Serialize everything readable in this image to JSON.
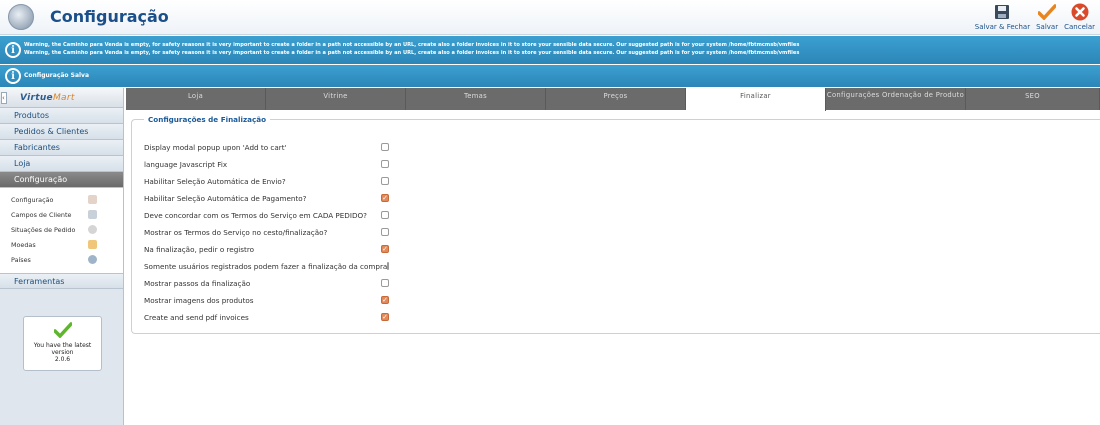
{
  "header": {
    "title": "Configuração",
    "buttons": [
      {
        "label": "Salvar & Fechar",
        "icon": "save-icon"
      },
      {
        "label": "Salvar",
        "icon": "check-icon"
      },
      {
        "label": "Cancelar",
        "icon": "cancel-icon"
      }
    ]
  },
  "messages": {
    "warning_lines": [
      "Warning, the Caminho para Venda is empty, for safety reasons it is very important to create a folder in a path not accessible by an URL, create also a folder invoices in it to store your sensible data secure. Our suggested path is for your system /home/fbtmcmsb/vmfiles",
      "Warning, the Caminho para Venda is empty, for safety reasons it is very important to create a folder in a path not accessible by an URL, create also a folder invoices in it to store your sensible data secure. Our suggested path is for your system /home/fbtmcmsb/vmfiles"
    ],
    "saved": "Configuração Salva"
  },
  "sidebar": {
    "logo_main": "Virtue",
    "logo_accent": "Mart",
    "items": [
      "Produtos",
      "Pedidos & Clientes",
      "Fabricantes",
      "Loja",
      "Configuração"
    ],
    "active_item": "Configuração",
    "sub_items": [
      {
        "label": "Configuração",
        "icon": "tools-icon"
      },
      {
        "label": "Campos de Cliente",
        "icon": "form-icon"
      },
      {
        "label": "Situações de Pedido",
        "icon": "status-icon"
      },
      {
        "label": "Moedas",
        "icon": "coins-icon"
      },
      {
        "label": "Países",
        "icon": "globe-icon"
      }
    ],
    "tools_item": "Ferramentas",
    "version": {
      "line1": "You have the latest",
      "line2": "version",
      "line3": "2.0.6"
    }
  },
  "tabs": [
    {
      "label": "Loja"
    },
    {
      "label": "Vitrine"
    },
    {
      "label": "Temas"
    },
    {
      "label": "Preços"
    },
    {
      "label": "Finalizar"
    },
    {
      "label": "Configurações Ordenação de Produto"
    },
    {
      "label": "SEO"
    }
  ],
  "active_tab": "Finalizar",
  "panel": {
    "legend": "Configurações de Finalização",
    "options": [
      {
        "label": "Display modal popup upon 'Add to cart'",
        "checked": false
      },
      {
        "label": "language Javascript Fix",
        "checked": false
      },
      {
        "label": "Habilitar Seleção Automática de Envio?",
        "checked": false
      },
      {
        "label": "Habilitar Seleção Automática de Pagamento?",
        "checked": true
      },
      {
        "label": "Deve concordar com os Termos do Serviço em CADA PEDIDO?",
        "checked": false
      },
      {
        "label": "Mostrar os Termos do Serviço no cesto/finalização?",
        "checked": false
      },
      {
        "label": "Na finalização, pedir o registro",
        "checked": true
      },
      {
        "label": "Somente usuários registrados podem fazer a finalização da compra",
        "checked": false
      },
      {
        "label": "Mostrar passos da finalização",
        "checked": false
      },
      {
        "label": "Mostrar imagens dos produtos",
        "checked": true
      },
      {
        "label": "Create and send pdf invoices",
        "checked": true
      }
    ]
  }
}
